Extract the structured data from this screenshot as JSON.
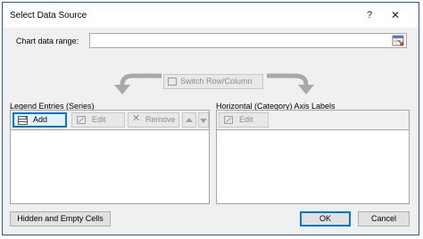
{
  "window": {
    "title": "Select Data Source",
    "help": "?",
    "close": "✕"
  },
  "range": {
    "label": "Chart data range:",
    "value": ""
  },
  "switch": {
    "label": "Switch Row/Column"
  },
  "legend": {
    "title": "Legend Entries (Series)",
    "add": "Add",
    "edit": "Edit",
    "remove": "Remove",
    "items": []
  },
  "axis": {
    "title": "Horizontal (Category) Axis Labels",
    "edit": "Edit",
    "items": []
  },
  "footer": {
    "hidden": "Hidden and Empty Cells",
    "ok": "OK",
    "cancel": "Cancel"
  }
}
